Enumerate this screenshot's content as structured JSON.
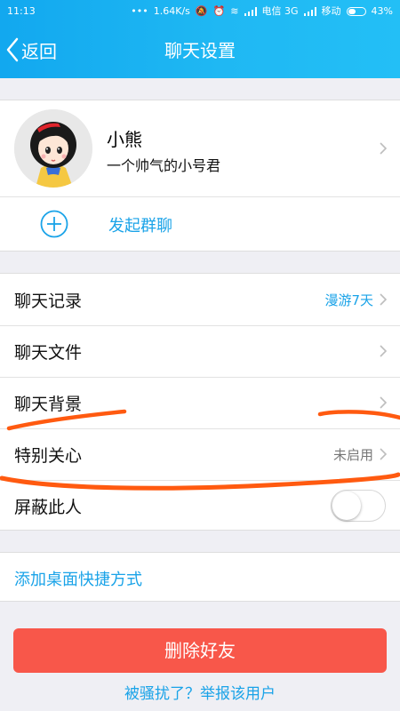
{
  "status_bar": {
    "time": "11:13",
    "network_speed": "1.64K/s",
    "carrier_1": "电信 3G",
    "carrier_2": "移动",
    "battery": "43%"
  },
  "header": {
    "back_label": "返回",
    "title": "聊天设置"
  },
  "profile": {
    "name": "小熊",
    "signature": "一个帅气的小号君"
  },
  "group_chat": {
    "label": "发起群聊"
  },
  "settings": {
    "chat_history": {
      "label": "聊天记录",
      "value": "漫游7天"
    },
    "chat_files": {
      "label": "聊天文件"
    },
    "chat_background": {
      "label": "聊天背景"
    },
    "special_care": {
      "label": "特别关心",
      "value": "未启用"
    },
    "block": {
      "label": "屏蔽此人",
      "enabled": false
    }
  },
  "shortcut": {
    "label": "添加桌面快捷方式"
  },
  "actions": {
    "delete_label": "删除好友",
    "report_label": "被骚扰了？举报该用户"
  },
  "colors": {
    "header_blue": "#1fb8f3",
    "link_blue": "#1aa3e8",
    "delete_red": "#f8574a",
    "annotation_orange": "#ff5a10"
  }
}
